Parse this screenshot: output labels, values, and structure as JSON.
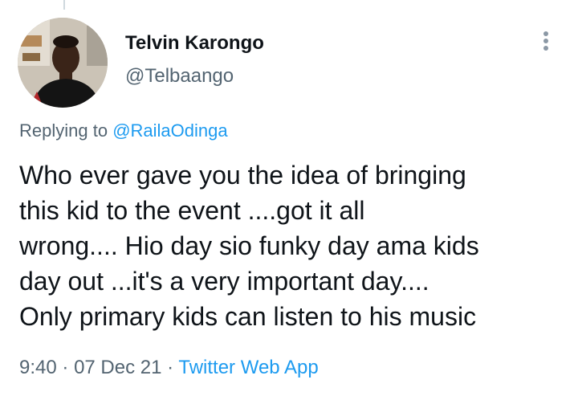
{
  "tweet": {
    "author": {
      "name": "Telvin Karongo",
      "handle": "@Telbaango"
    },
    "reply_context": {
      "prefix": "Replying to",
      "mention": "@RailaOdinga"
    },
    "text_lines": [
      "Who ever gave you the idea of bringing",
      "this kid to the event ....got it all",
      "wrong.... Hio day sio funky day ama kids",
      "day out ...it's a very important day....",
      "Only primary kids can listen to his music"
    ],
    "time": "9:40",
    "separator": "·",
    "date": "07 Dec 21",
    "source": "Twitter Web App"
  },
  "colors": {
    "text": "#0f1419",
    "secondary": "#536471",
    "link": "#1d9bf0"
  },
  "icons": {
    "more": "more-vertical-icon"
  }
}
